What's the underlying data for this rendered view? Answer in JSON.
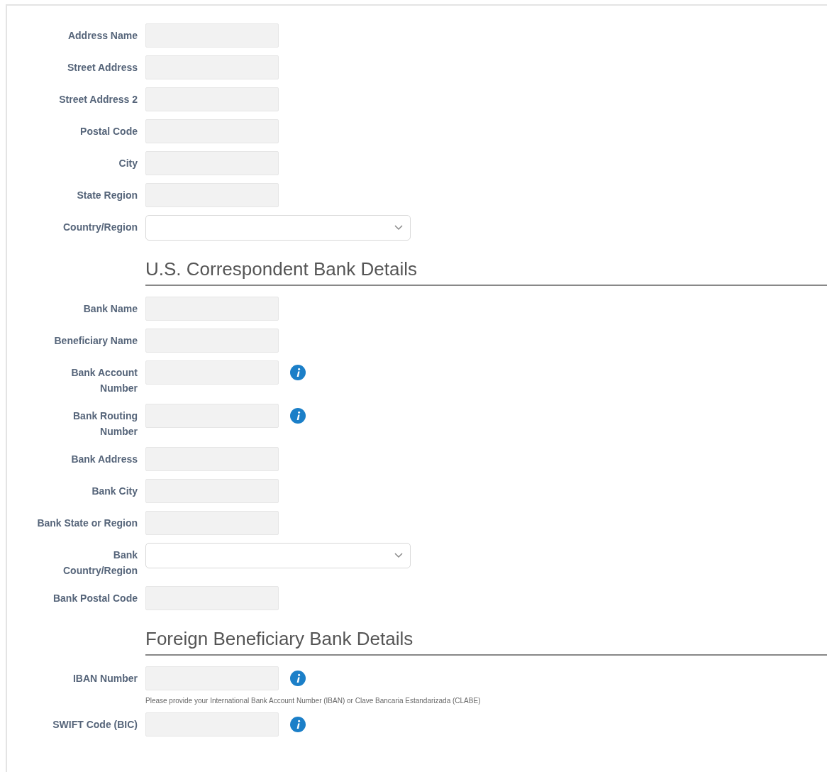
{
  "sections": [
    {
      "fields": [
        {
          "label": "Address Name",
          "kind": "text",
          "info": false
        },
        {
          "label": "Street Address",
          "kind": "text",
          "info": false
        },
        {
          "label": "Street Address 2",
          "kind": "text",
          "info": false
        },
        {
          "label": "Postal Code",
          "kind": "text",
          "info": false
        },
        {
          "label": "City",
          "kind": "text",
          "info": false
        },
        {
          "label": "State Region",
          "kind": "text",
          "info": false
        },
        {
          "label": "Country/Region",
          "kind": "select",
          "info": false
        }
      ]
    },
    {
      "title": "U.S. Correspondent Bank Details",
      "fields": [
        {
          "label": "Bank Name",
          "kind": "text",
          "info": false
        },
        {
          "label": "Beneficiary Name",
          "kind": "text",
          "info": false
        },
        {
          "label": "Bank Account\nNumber",
          "kind": "text",
          "info": true
        },
        {
          "label": "Bank Routing\nNumber",
          "kind": "text",
          "info": true
        },
        {
          "label": "Bank Address",
          "kind": "text",
          "info": false
        },
        {
          "label": "Bank City",
          "kind": "text",
          "info": false
        },
        {
          "label": "Bank State or Region",
          "kind": "text",
          "info": false
        },
        {
          "label": "Bank\nCountry/Region",
          "kind": "select",
          "info": false
        },
        {
          "label": "Bank Postal Code",
          "kind": "text",
          "info": false
        }
      ]
    },
    {
      "title": "Foreign Beneficiary Bank Details",
      "fields": [
        {
          "label": "IBAN Number",
          "kind": "text",
          "info": true,
          "help": "Please provide your International Bank Account Number (IBAN) or Clave Bancaria Estandarizada (CLABE)"
        },
        {
          "label": "SWIFT Code (BIC)",
          "kind": "text",
          "info": true
        }
      ]
    }
  ]
}
